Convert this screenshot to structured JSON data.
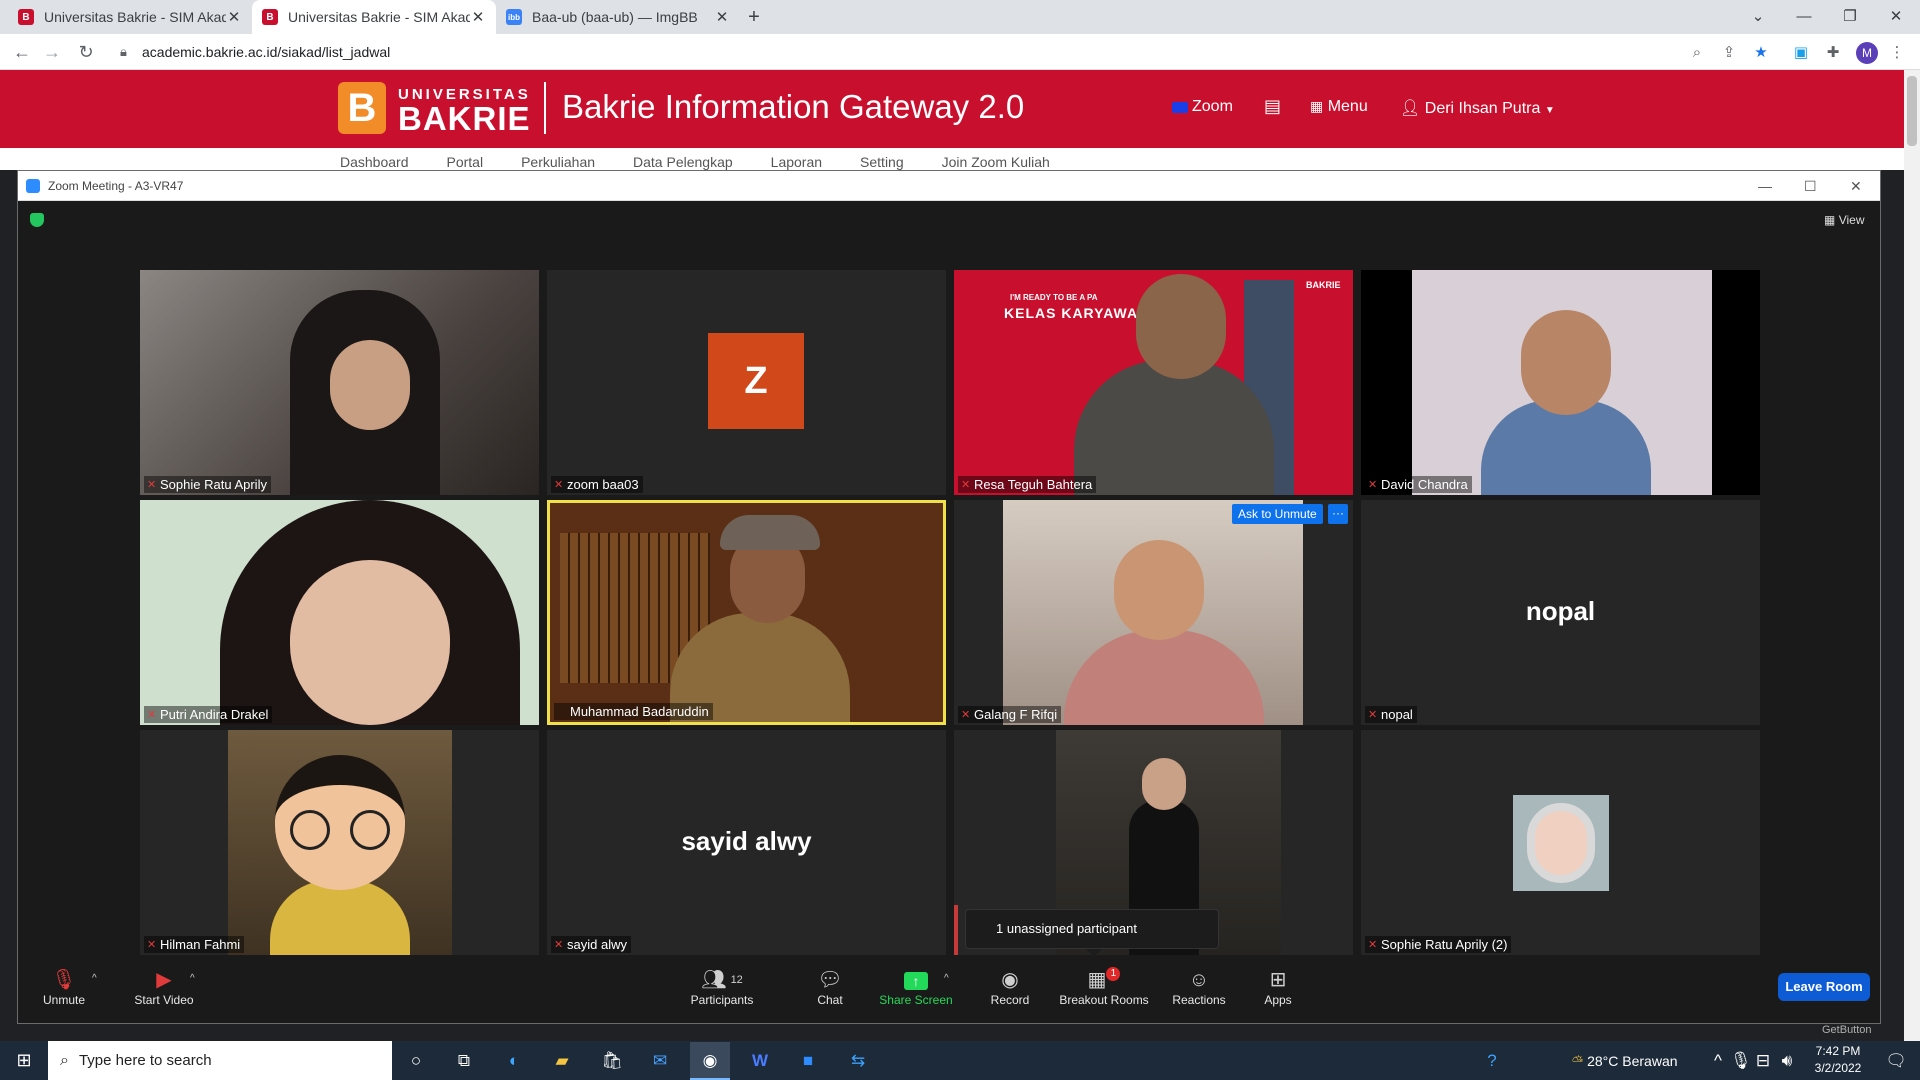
{
  "browser": {
    "tabs": [
      {
        "title": "Universitas Bakrie - SIM Akadem"
      },
      {
        "title": "Universitas Bakrie - SIM Akadem"
      },
      {
        "title": "Baa-ub (baa-ub) — ImgBB"
      }
    ],
    "url": "academic.bakrie.ac.id/siakad/list_jadwal",
    "profile_initial": "M"
  },
  "site": {
    "logo_top": "UNIVERSITAS",
    "logo_bottom": "BAKRIE",
    "title": "Bakrie Information Gateway 2.0",
    "nav": {
      "zoom": "Zoom",
      "menu": "Menu",
      "user": "Deri Ihsan Putra"
    },
    "subnav": [
      "Dashboard",
      "Portal",
      "Perkuliahan",
      "Data Pelengkap",
      "Laporan",
      "Setting",
      "Join Zoom Kuliah"
    ]
  },
  "zoom": {
    "window_title": "Zoom Meeting - A3-VR47",
    "view_label": "View",
    "tiles": [
      {
        "name": "Sophie Ratu Aprily",
        "big": ""
      },
      {
        "name": "zoom baa03",
        "big": ""
      },
      {
        "name": "Resa Teguh Bahtera",
        "big": ""
      },
      {
        "name": "David Chandra",
        "big": ""
      },
      {
        "name": "Putri Andira Drakel",
        "big": ""
      },
      {
        "name": "Muhammad Badaruddin",
        "big": ""
      },
      {
        "name": "Galang F Rifqi",
        "big": ""
      },
      {
        "name": "nopal",
        "big": "nopal"
      },
      {
        "name": "Hilman Fahmi",
        "big": ""
      },
      {
        "name": "sayid alwy",
        "big": "sayid alwy"
      },
      {
        "name": "",
        "big": ""
      },
      {
        "name": "Sophie Ratu Aprily (2)",
        "big": ""
      }
    ],
    "avatar_letter": "Z",
    "banner_text1": "I'M READY TO BE A PA",
    "banner_text2": "KELAS KARYAWA",
    "banner_logo": "BAKRIE",
    "ask_unmute": "Ask to Unmute",
    "ask_more": "···",
    "unassigned": "1 unassigned participant",
    "toolbar": {
      "unmute": "Unmute",
      "start_video": "Start Video",
      "participants": "Participants",
      "participants_count": "12",
      "chat": "Chat",
      "share": "Share Screen",
      "record": "Record",
      "breakout": "Breakout Rooms",
      "breakout_badge": "1",
      "reactions": "Reactions",
      "apps": "Apps",
      "leave": "Leave Room"
    },
    "watermark": "GetButton"
  },
  "taskbar": {
    "search_placeholder": "Type here to search",
    "weather": "28°C  Berawan",
    "time": "7:42 PM",
    "date": "3/2/2022"
  },
  "colors": {
    "brand_red": "#c8102e",
    "zoom_blue": "#0e72ed",
    "share_green": "#23d959",
    "leave_blue": "#0e5bd6",
    "speaker_border": "#f0e04a"
  }
}
